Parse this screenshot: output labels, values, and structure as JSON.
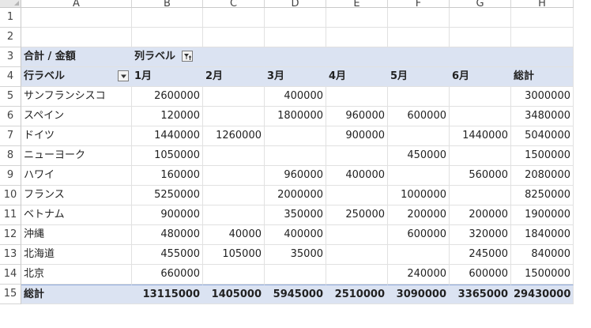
{
  "columns": [
    "A",
    "B",
    "C",
    "D",
    "E",
    "F",
    "G",
    "H"
  ],
  "row_numbers": [
    "1",
    "2",
    "3",
    "4",
    "5",
    "6",
    "7",
    "8",
    "9",
    "10",
    "11",
    "12",
    "13",
    "14",
    "15"
  ],
  "pivot": {
    "value_label": "合計 / 金額",
    "col_label": "列ラベル",
    "row_label": "行ラベル",
    "months": [
      "1月",
      "2月",
      "3月",
      "4月",
      "5月",
      "6月"
    ],
    "grand_total_label": "総計",
    "rows": [
      {
        "label": "サンフランシスコ",
        "vals": [
          "2600000",
          "",
          "400000",
          "",
          "",
          "",
          "3000000"
        ]
      },
      {
        "label": "スペイン",
        "vals": [
          "120000",
          "",
          "1800000",
          "960000",
          "600000",
          "",
          "3480000"
        ]
      },
      {
        "label": "ドイツ",
        "vals": [
          "1440000",
          "1260000",
          "",
          "900000",
          "",
          "1440000",
          "5040000"
        ]
      },
      {
        "label": "ニューヨーク",
        "vals": [
          "1050000",
          "",
          "",
          "",
          "450000",
          "",
          "1500000"
        ]
      },
      {
        "label": "ハワイ",
        "vals": [
          "160000",
          "",
          "960000",
          "400000",
          "",
          "560000",
          "2080000"
        ]
      },
      {
        "label": "フランス",
        "vals": [
          "5250000",
          "",
          "2000000",
          "",
          "1000000",
          "",
          "8250000"
        ]
      },
      {
        "label": "ベトナム",
        "vals": [
          "900000",
          "",
          "350000",
          "250000",
          "200000",
          "200000",
          "1900000"
        ]
      },
      {
        "label": "沖縄",
        "vals": [
          "480000",
          "40000",
          "400000",
          "",
          "600000",
          "320000",
          "1840000"
        ]
      },
      {
        "label": "北海道",
        "vals": [
          "455000",
          "105000",
          "35000",
          "",
          "",
          "245000",
          "840000"
        ]
      },
      {
        "label": "北京",
        "vals": [
          "660000",
          "",
          "",
          "",
          "240000",
          "600000",
          "1500000"
        ]
      }
    ],
    "totals": [
      "13115000",
      "1405000",
      "5945000",
      "2510000",
      "3090000",
      "3365000",
      "29430000"
    ]
  },
  "icons": {
    "col_filter": "filter-applied-icon",
    "row_filter": "dropdown-arrow-icon"
  }
}
